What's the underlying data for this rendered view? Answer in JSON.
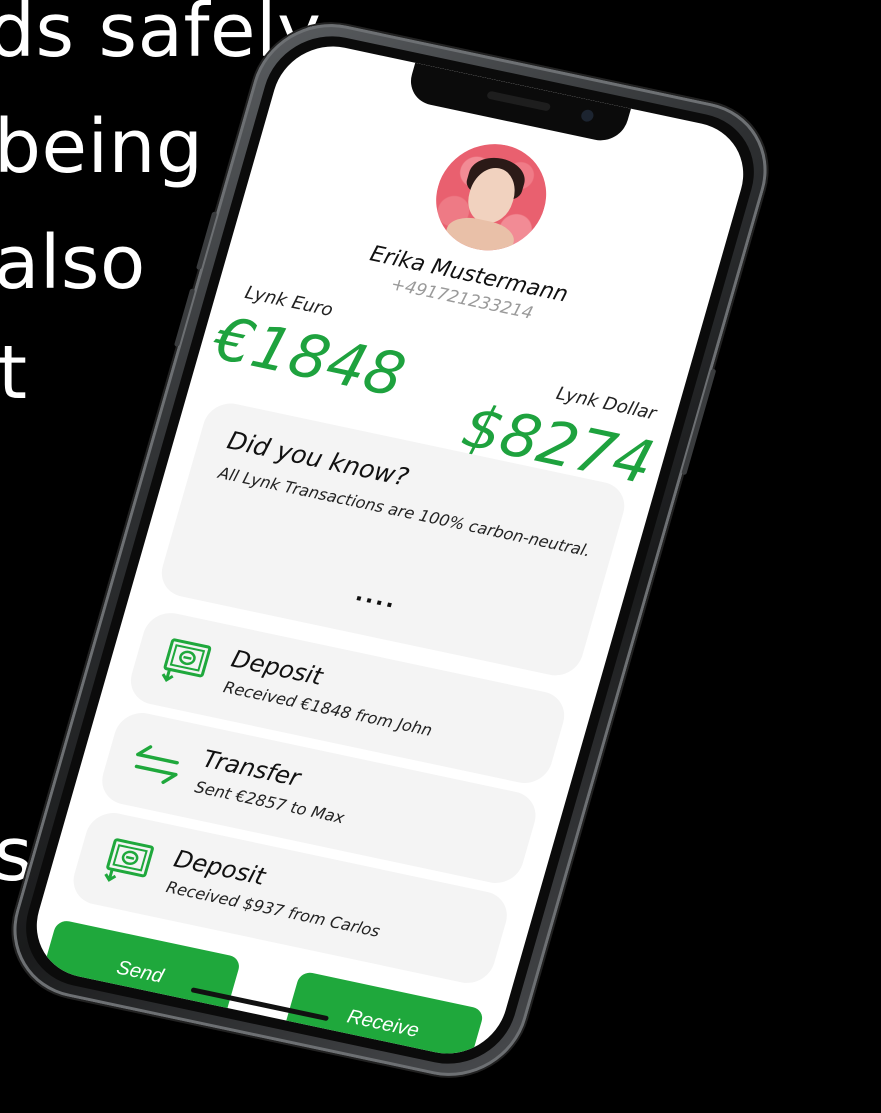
{
  "background_text": [
    "ds safely",
    "being",
    "also",
    "t",
    "s"
  ],
  "profile": {
    "name": "Erika Mustermann",
    "phone": "+491721233214"
  },
  "balances": {
    "euro": {
      "label": "Lynk Euro",
      "value": "€1848"
    },
    "dollar": {
      "label": "Lynk Dollar",
      "value": "$8274"
    }
  },
  "tip": {
    "title": "Did you know?",
    "body": "All Lynk Transactions are 100% carbon-neutral.",
    "dots": "...."
  },
  "transactions": [
    {
      "type": "Deposit",
      "description": "Received €1848 from John",
      "icon": "deposit-icon"
    },
    {
      "type": "Transfer",
      "description": "Sent €2857 to Max",
      "icon": "transfer-icon"
    },
    {
      "type": "Deposit",
      "description": "Received $937 from Carlos",
      "icon": "deposit-icon"
    }
  ],
  "actions": {
    "send": "Send",
    "receive": "Receive"
  },
  "colors": {
    "accent": "#1fa83c",
    "balance": "#1ea23e",
    "card": "#f4f4f4",
    "background": "#000000"
  }
}
